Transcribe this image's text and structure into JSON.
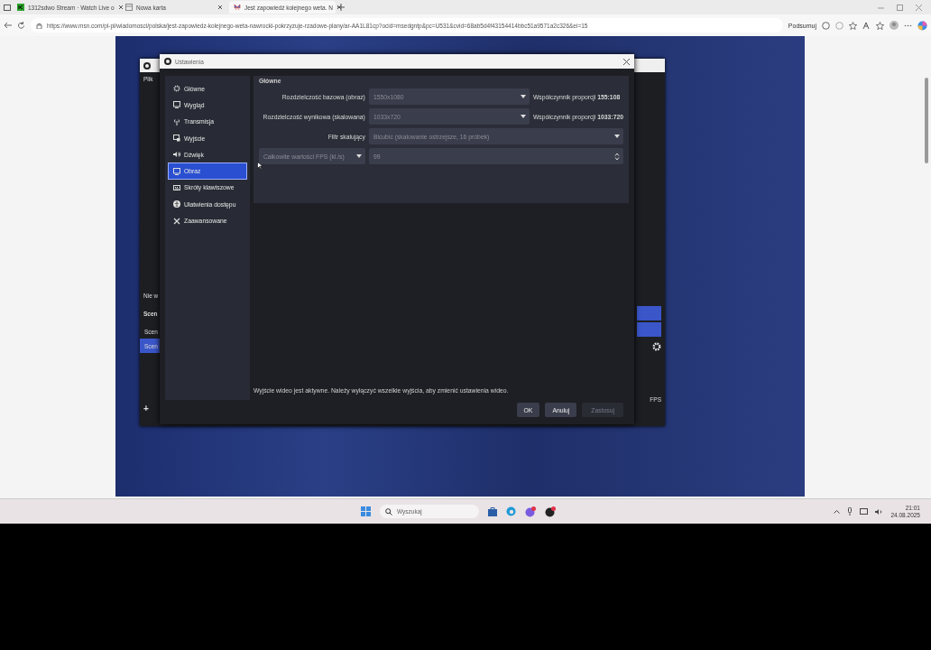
{
  "browser": {
    "tabs": [
      {
        "title": "1312sdwo Stream · Watch Live o",
        "selected": false
      },
      {
        "title": "Nowa karta",
        "selected": false
      },
      {
        "title": "Jest zapowiedź kolejnego weta. N",
        "selected": true
      }
    ],
    "url": "https://www.msn.com/pl-pl/wiadomosci/polska/jest-zapowiedz-kolejnego-weta-nawrocki-pokrzyzuje-rzadowe-plany/ar-AA1L81cp?ocid=msedgntp&pc=U531&cvid=68ab5d4f43154414bbc51a9571a2c326&ei=15",
    "summarize": "Podsumuj"
  },
  "obs_main": {
    "menu": "Plik",
    "status": "Nie w",
    "scenes_header": "Scen",
    "scenes": [
      {
        "name": "Scen",
        "selected": false
      },
      {
        "name": "Scen",
        "selected": true
      }
    ],
    "add_button": "+",
    "fps": "FPS"
  },
  "settings": {
    "title": "Ustawienia",
    "sidebar": [
      {
        "label": "Główne",
        "selected": false
      },
      {
        "label": "Wygląd",
        "selected": false
      },
      {
        "label": "Transmisja",
        "selected": false
      },
      {
        "label": "Wyjście",
        "selected": false
      },
      {
        "label": "Dźwięk",
        "selected": false
      },
      {
        "label": "Obraz",
        "selected": true
      },
      {
        "label": "Skróty klawiszowe",
        "selected": false
      },
      {
        "label": "Ułatwienia dostępu",
        "selected": false
      },
      {
        "label": "Zaawansowane",
        "selected": false
      }
    ],
    "section": "Główne",
    "rows": [
      {
        "kind": "combo",
        "label": "Rozdzielczość bazowa (obraz)",
        "value": "1550x1080",
        "aspect": "Współczynnik proporcji **155:108**",
        "disabled": true
      },
      {
        "kind": "combo",
        "label": "Rozdzielczość wynikowa (skalowana)",
        "value": "1033x720",
        "aspect": "Współczynnik proporcji **1033:720**",
        "disabled": true
      },
      {
        "kind": "wide",
        "label": "Filtr skalujący",
        "value": "Bicubic (skalowanie ostrzejsze, 16 próbek)",
        "disabled": true
      },
      {
        "kind": "spin",
        "label": "Całkowite wartości FPS (kl./s)",
        "value": "99",
        "disabled": true
      }
    ],
    "notice": "Wyjście wideo jest aktywne. Należy wyłączyć wszelkie wyjścia, aby zmienić ustawienia wideo.",
    "buttons": [
      {
        "label": "OK",
        "disabled": false
      },
      {
        "label": "Anuluj",
        "disabled": false
      },
      {
        "label": "Zastosuj",
        "disabled": true
      }
    ]
  },
  "taskbar": {
    "search_placeholder": "Wyszukaj",
    "time": "21:01",
    "date": "24.08.2025"
  }
}
